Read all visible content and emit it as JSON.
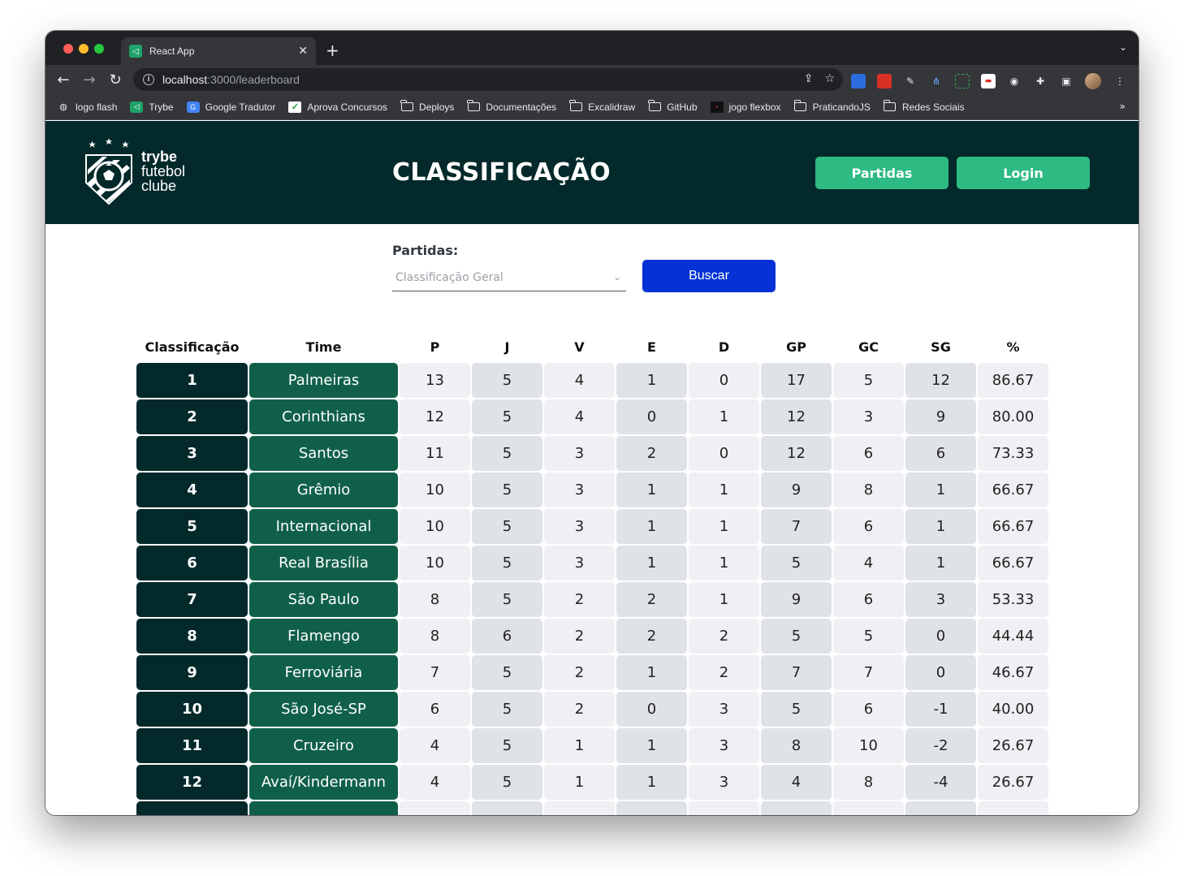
{
  "browser": {
    "tab_title": "React App",
    "tab_favicon": "trybe-favicon",
    "url_host": "localhost",
    "url_path": ":3000/leaderboard",
    "bookmarks": [
      {
        "label": "logo flash",
        "icon": "globe-icon"
      },
      {
        "label": "Trybe",
        "icon": "trybe-icon"
      },
      {
        "label": "Google Tradutor",
        "icon": "translate-icon"
      },
      {
        "label": "Aprova Concursos",
        "icon": "check-icon"
      },
      {
        "label": "Deploys",
        "icon": "folder-icon"
      },
      {
        "label": "Documentações",
        "icon": "folder-icon"
      },
      {
        "label": "Excalidraw",
        "icon": "folder-icon"
      },
      {
        "label": "GitHub",
        "icon": "folder-icon"
      },
      {
        "label": "jogo flexbox",
        "icon": "game-icon"
      },
      {
        "label": "PraticandoJS",
        "icon": "folder-icon"
      },
      {
        "label": "Redes Sociais",
        "icon": "folder-icon"
      }
    ]
  },
  "header": {
    "logo_line1": "trybe",
    "logo_line2": "futebol",
    "logo_line3": "clube",
    "title": "CLASSIFICAÇÃO",
    "partidas_button": "Partidas",
    "login_button": "Login"
  },
  "filter": {
    "label": "Partidas:",
    "selected": "Classificação Geral",
    "search_button": "Buscar"
  },
  "table": {
    "columns": [
      "Classificação",
      "Time",
      "P",
      "J",
      "V",
      "E",
      "D",
      "GP",
      "GC",
      "SG",
      "%"
    ],
    "rows": [
      [
        "1",
        "Palmeiras",
        "13",
        "5",
        "4",
        "1",
        "0",
        "17",
        "5",
        "12",
        "86.67"
      ],
      [
        "2",
        "Corinthians",
        "12",
        "5",
        "4",
        "0",
        "1",
        "12",
        "3",
        "9",
        "80.00"
      ],
      [
        "3",
        "Santos",
        "11",
        "5",
        "3",
        "2",
        "0",
        "12",
        "6",
        "6",
        "73.33"
      ],
      [
        "4",
        "Grêmio",
        "10",
        "5",
        "3",
        "1",
        "1",
        "9",
        "8",
        "1",
        "66.67"
      ],
      [
        "5",
        "Internacional",
        "10",
        "5",
        "3",
        "1",
        "1",
        "7",
        "6",
        "1",
        "66.67"
      ],
      [
        "6",
        "Real Brasília",
        "10",
        "5",
        "3",
        "1",
        "1",
        "5",
        "4",
        "1",
        "66.67"
      ],
      [
        "7",
        "São Paulo",
        "8",
        "5",
        "2",
        "2",
        "1",
        "9",
        "6",
        "3",
        "53.33"
      ],
      [
        "8",
        "Flamengo",
        "8",
        "6",
        "2",
        "2",
        "2",
        "5",
        "5",
        "0",
        "44.44"
      ],
      [
        "9",
        "Ferroviária",
        "7",
        "5",
        "2",
        "1",
        "2",
        "7",
        "7",
        "0",
        "46.67"
      ],
      [
        "10",
        "São José-SP",
        "6",
        "5",
        "2",
        "0",
        "3",
        "5",
        "6",
        "-1",
        "40.00"
      ],
      [
        "11",
        "Cruzeiro",
        "4",
        "5",
        "1",
        "1",
        "3",
        "8",
        "10",
        "-2",
        "26.67"
      ],
      [
        "12",
        "Avaí/Kindermann",
        "4",
        "5",
        "1",
        "1",
        "3",
        "4",
        "8",
        "-4",
        "26.67"
      ],
      [
        "",
        "",
        "",
        "",
        "",
        "",
        "",
        "",
        "",
        "",
        ""
      ]
    ]
  },
  "colors": {
    "header_bg": "#04292b",
    "accent_green": "#2eba83",
    "team_green": "#106049",
    "search_blue": "#0432d6"
  }
}
